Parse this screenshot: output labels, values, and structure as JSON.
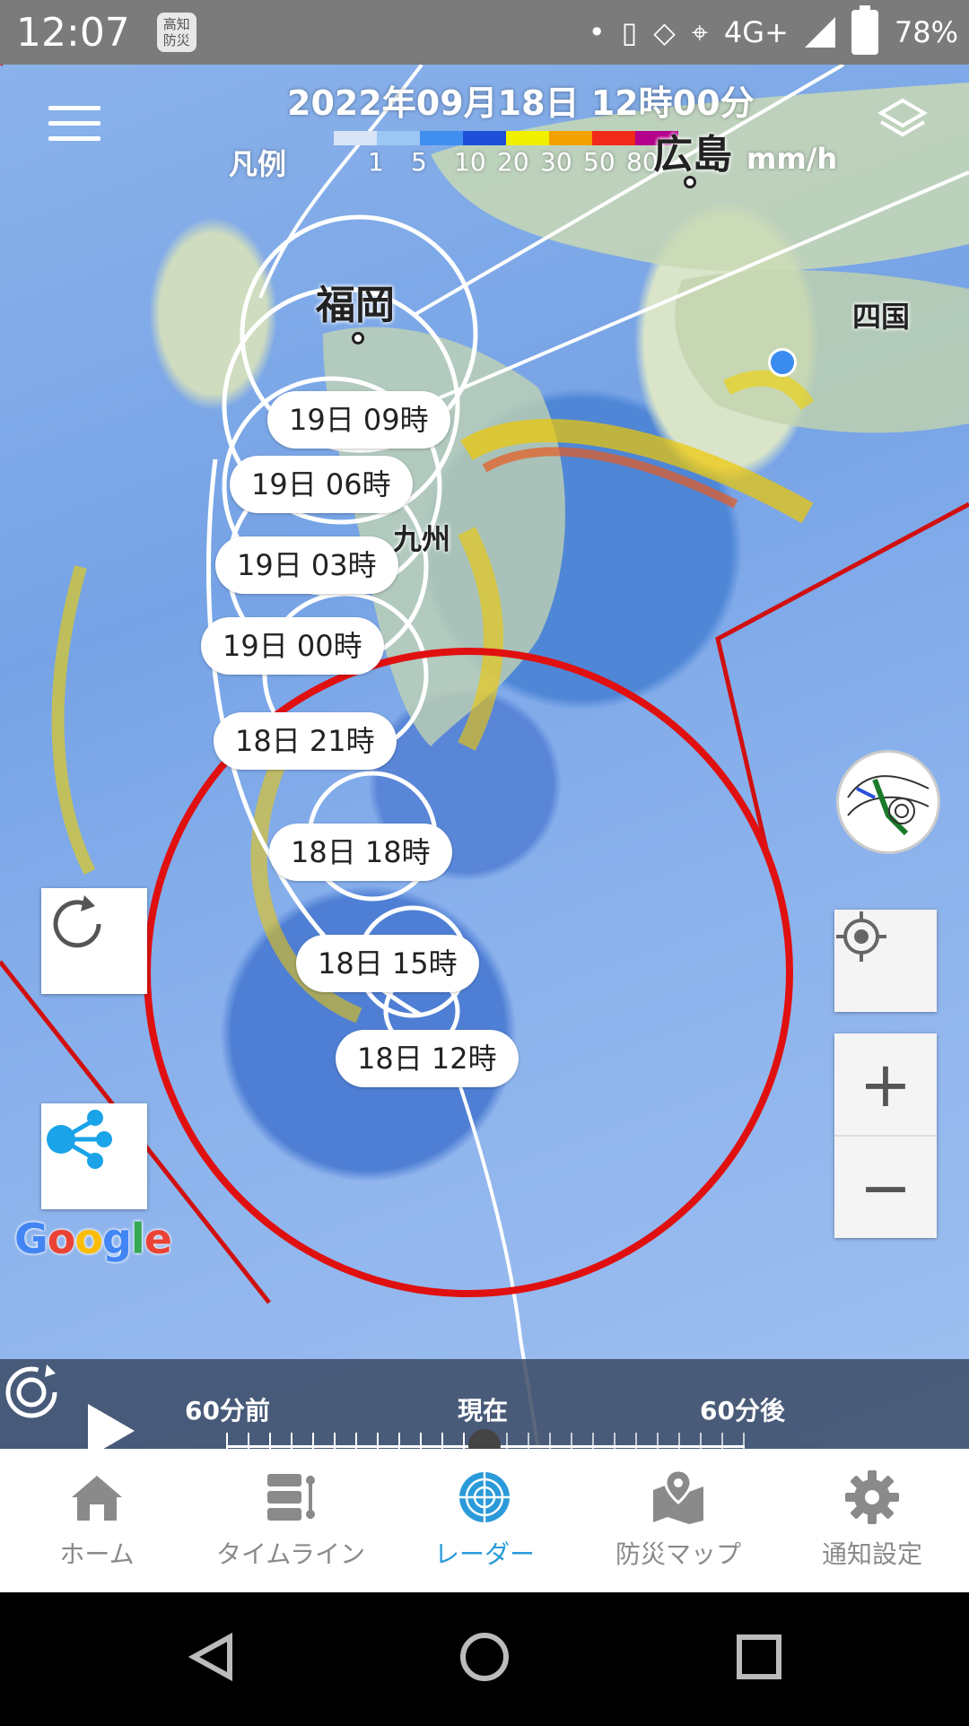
{
  "status_bar": {
    "time": "12:07",
    "app_badge": "高知\n防災",
    "network": "4G+",
    "battery": "78%"
  },
  "map": {
    "timestamp_title": "2022年09月18日 12時00分",
    "legend": {
      "label": "凡例",
      "ticks": [
        "1",
        "5",
        "10",
        "20",
        "30",
        "50",
        "80"
      ],
      "unit": "mm/h",
      "colors": [
        "#d9e4f7",
        "#9cc6f3",
        "#3f8ff0",
        "#1f4fd8",
        "#f0f000",
        "#f2a100",
        "#f22a1a",
        "#b4008c"
      ]
    },
    "places": {
      "hiroshima": "広島",
      "fukuoka": "福岡",
      "shikoku": "四国",
      "kyushu": "九州"
    },
    "typhoon_track_labels": [
      "19日 09時",
      "19日 06時",
      "19日 03時",
      "19日 00時",
      "18日 21時",
      "18日 18時",
      "18日 15時",
      "18日 12時"
    ],
    "google": "Google"
  },
  "timeline": {
    "start_label": "60分前",
    "now_label": "現在",
    "end_label": "60分後"
  },
  "bottom_nav": [
    {
      "label": "ホーム",
      "icon": "home-icon"
    },
    {
      "label": "タイムライン",
      "icon": "timeline-icon"
    },
    {
      "label": "レーダー",
      "icon": "radar-icon",
      "active": true
    },
    {
      "label": "防災マップ",
      "icon": "disaster-map-icon"
    },
    {
      "label": "通知設定",
      "icon": "gear-icon"
    }
  ],
  "colors": {
    "accent": "#2a9ad9",
    "storm_circle": "#e01010",
    "nav_inactive": "#8a8a8a"
  }
}
